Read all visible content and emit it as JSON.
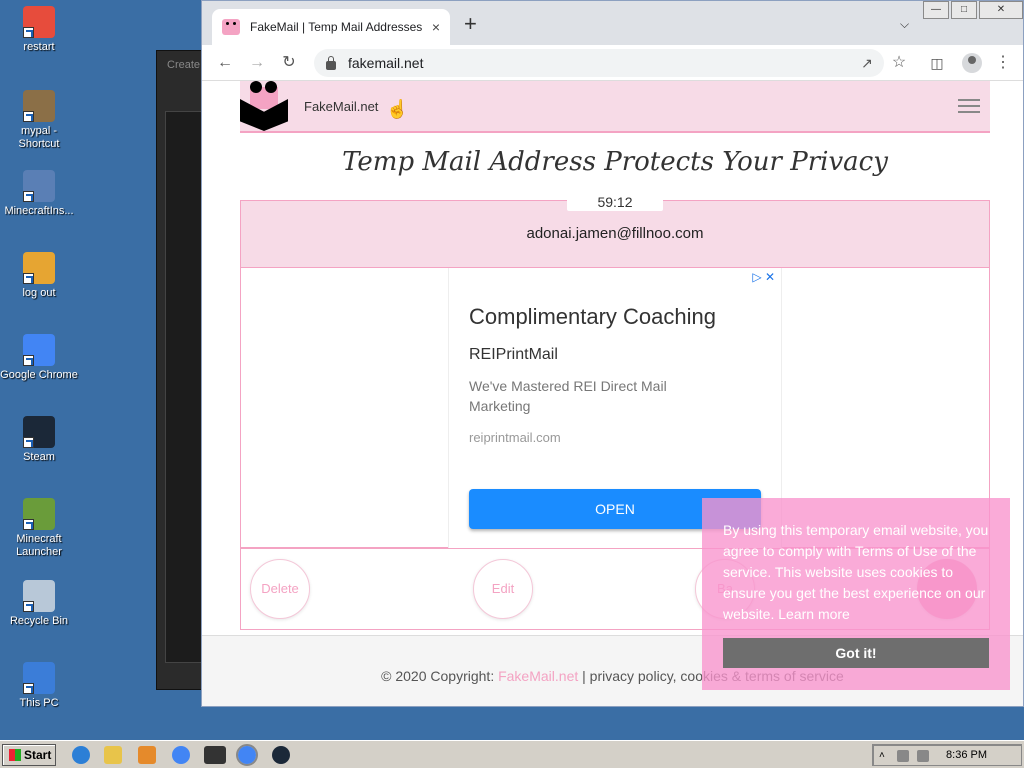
{
  "desktop": {
    "icons": [
      {
        "label": "restart",
        "name": "restart-icon",
        "color": "#e74c3c"
      },
      {
        "label": "mypal - Shortcut",
        "name": "mypal-icon",
        "color": "#8b6f47"
      },
      {
        "label": "MinecraftIns...",
        "name": "minecraft-installer-icon",
        "color": "#5a7fb5"
      },
      {
        "label": "log out",
        "name": "logout-icon",
        "color": "#e6a532"
      },
      {
        "label": "Google Chrome",
        "name": "chrome-icon",
        "color": "#4285f4"
      },
      {
        "label": "Steam",
        "name": "steam-icon",
        "color": "#1b2838"
      },
      {
        "label": "Minecraft Launcher",
        "name": "minecraft-launcher-icon",
        "color": "#6a9c3a"
      },
      {
        "label": "Recycle Bin",
        "name": "recycle-bin-icon",
        "color": "#b8c8d8"
      },
      {
        "label": "This PC",
        "name": "this-pc-icon",
        "color": "#3b7dd8"
      }
    ],
    "background_window_title": "Create"
  },
  "browser": {
    "tab_title": "FakeMail | Temp Mail Addresses",
    "tab_close": "×",
    "new_tab": "+",
    "url": "fakemail.net"
  },
  "site": {
    "brand": "FakeMail.net",
    "headline": "Temp Mail Address Protects Your Privacy",
    "timer": "59:12",
    "email": "adonai.jamen@fillnoo.com",
    "ad": {
      "title": "Complimentary Coaching",
      "advertiser": "REIPrintMail",
      "description": "We've Mastered REI Direct Mail Marketing",
      "url": "reiprintmail.com",
      "cta": "OPEN"
    },
    "actions": {
      "delete": "Delete",
      "edit": "Edit",
      "third": "Ba"
    },
    "footer": {
      "prefix": "© 2020 Copyright: ",
      "link": "FakeMail.net",
      "rest": " | privacy policy, cookies & terms of service"
    },
    "cookie": {
      "message": "By using this temporary email website, you agree to comply with Terms of Use of the service. This website uses cookies to ensure you get the best experience on our website.",
      "learn_more": "Learn more",
      "button": "Got it!"
    }
  },
  "taskbar": {
    "start": "Start",
    "time": "8:36 PM"
  },
  "colors": {
    "accent_pink": "#f4a3c3",
    "header_pink": "#f7dbe7",
    "ad_button": "#1a8cff",
    "desktop": "#3a6ea5"
  }
}
